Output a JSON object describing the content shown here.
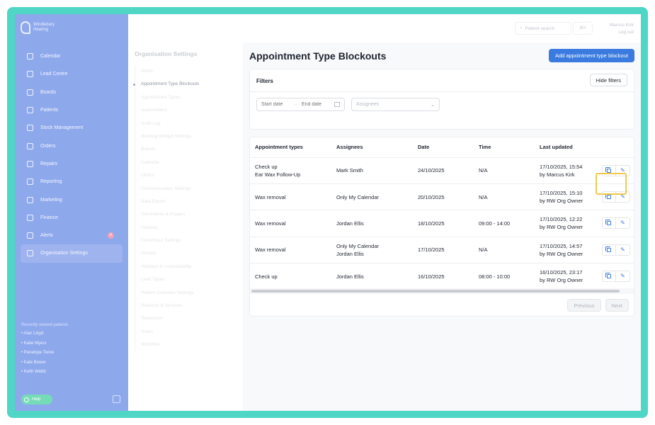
{
  "brand": {
    "name_line1": "Windlebury",
    "name_line2": "Hearing"
  },
  "sidebar": {
    "items": [
      {
        "label": "Calendar",
        "icon": "calendar-icon"
      },
      {
        "label": "Lead Centre",
        "icon": "headset-icon"
      },
      {
        "label": "Boards",
        "icon": "board-icon"
      },
      {
        "label": "Patients",
        "icon": "patients-icon"
      },
      {
        "label": "Stock Management",
        "icon": "box-icon"
      },
      {
        "label": "Orders",
        "icon": "orders-icon"
      },
      {
        "label": "Repairs",
        "icon": "wrench-icon"
      },
      {
        "label": "Reporting",
        "icon": "chart-icon"
      },
      {
        "label": "Marketing",
        "icon": "megaphone-icon"
      },
      {
        "label": "Finance",
        "icon": "card-icon"
      },
      {
        "label": "Alerts",
        "icon": "bell-icon",
        "badge": "6"
      },
      {
        "label": "Organisation Settings",
        "icon": "gear-icon"
      }
    ],
    "recent_title": "Recently viewed patients",
    "recent": [
      "• Alan Lloyd",
      "• Katie Myers",
      "• Penelope Twine",
      "• Kate Bower",
      "• Keith Webb"
    ],
    "help_label": "Help"
  },
  "topbar": {
    "search_placeholder": "Patient search",
    "shortcut": "⌘K",
    "user_name": "Marcus Kirk",
    "logout": "Log out"
  },
  "subnav": {
    "title": "Organisation Settings",
    "items": [
      "Alerts",
      "Appointment Type Blockouts",
      "Appointment Types",
      "Audiometers",
      "Audit Log",
      "Booking Widget Settings",
      "Brands",
      "Calendar",
      "Clinics",
      "Communication Settings",
      "Data Export",
      "Documents & Images",
      "Finance",
      "Form/Input Settings",
      "Groups",
      "Holidays & Unavailability",
      "Lead Types",
      "Patient Overview Settings",
      "Products & Services",
      "Resources",
      "Users",
      "Workflow"
    ]
  },
  "main": {
    "title": "Appointment Type Blockouts",
    "add_button": "Add appointment type blockout",
    "filters": {
      "title": "Filters",
      "hide_button": "Hide filters",
      "start_placeholder": "Start date",
      "end_placeholder": "End date",
      "assignees_placeholder": "Assignees"
    },
    "table": {
      "headers": [
        "Appointment types",
        "Assignees",
        "Date",
        "Time",
        "Last updated"
      ],
      "rows": [
        {
          "types": [
            "Check up",
            "Ear Wax Follow-Up"
          ],
          "assignees": [
            "Mark Smith"
          ],
          "date": "24/10/2025",
          "time": "N/A",
          "updated": [
            "17/10/2025, 15:54",
            "by Marcus Kirk"
          ]
        },
        {
          "types": [
            "Wax removal"
          ],
          "assignees": [
            "Only My Calendar"
          ],
          "date": "20/10/2025",
          "time": "N/A",
          "updated": [
            "17/10/2025, 15:10",
            "by RW Org Owner"
          ]
        },
        {
          "types": [
            "Wax removal"
          ],
          "assignees": [
            "Jordan Ellis"
          ],
          "date": "18/10/2025",
          "time": "09:00 - 14:00",
          "updated": [
            "17/10/2025, 12:22",
            "by RW Org Owner"
          ]
        },
        {
          "types": [
            "Wax removal"
          ],
          "assignees": [
            "Only My Calendar",
            "Jordan Ellis"
          ],
          "date": "17/10/2025",
          "time": "N/A",
          "updated": [
            "17/10/2025, 14:57",
            "by RW Org Owner"
          ]
        },
        {
          "types": [
            "Check up"
          ],
          "assignees": [
            "Jordan Ellis"
          ],
          "date": "16/10/2025",
          "time": "08:00 - 10:00",
          "updated": [
            "16/10/2025, 23:17",
            "by RW Org Owner"
          ]
        }
      ]
    },
    "pagination": {
      "previous": "Previous",
      "next": "Next"
    }
  },
  "colors": {
    "accent": "#3b7bdf",
    "sidebar": "#8ea8ec",
    "frame": "#4fd6c4",
    "highlight": "#f2c94c"
  }
}
